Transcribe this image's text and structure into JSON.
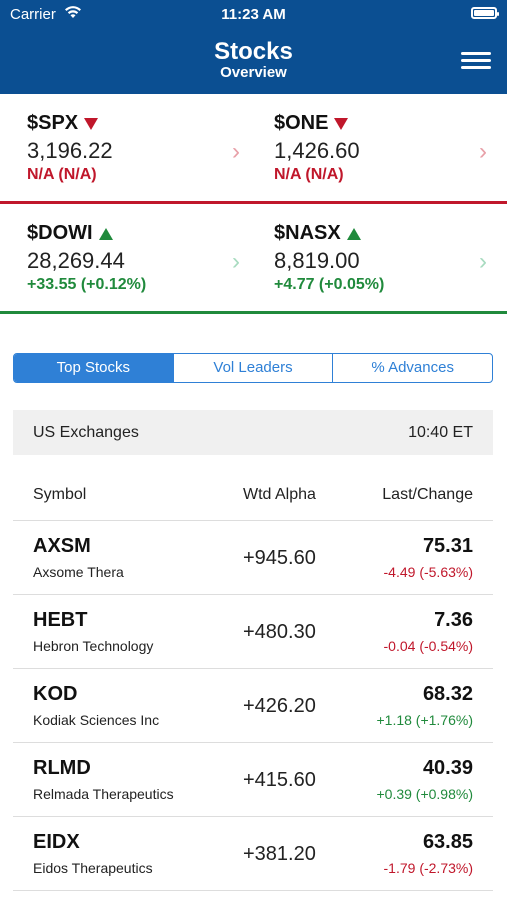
{
  "status": {
    "carrier": "Carrier",
    "time": "11:23 AM"
  },
  "header": {
    "title": "Stocks",
    "subtitle": "Overview"
  },
  "indices": [
    {
      "symbol": "$SPX",
      "price": "3,196.22",
      "change": "N/A (N/A)",
      "direction": "down",
      "color": "#c0172b"
    },
    {
      "symbol": "$ONE",
      "price": "1,426.60",
      "change": "N/A (N/A)",
      "direction": "down",
      "color": "#c0172b"
    },
    {
      "symbol": "$DOWI",
      "price": "28,269.44",
      "change": "+33.55 (+0.12%)",
      "direction": "up",
      "color": "#208a3c"
    },
    {
      "symbol": "$NASX",
      "price": "8,819.00",
      "change": "+4.77 (+0.05%)",
      "direction": "up",
      "color": "#208a3c"
    }
  ],
  "tabs": [
    {
      "label": "Top Stocks",
      "active": true
    },
    {
      "label": "Vol Leaders",
      "active": false
    },
    {
      "label": "% Advances",
      "active": false
    }
  ],
  "exchange": {
    "label": "US Exchanges",
    "time": "10:40 ET"
  },
  "table": {
    "headers": {
      "symbol": "Symbol",
      "alpha": "Wtd Alpha",
      "last": "Last/Change"
    },
    "rows": [
      {
        "symbol": "AXSM",
        "name": "Axsome Thera",
        "alpha": "+945.60",
        "last": "75.31",
        "change": "-4.49 (-5.63%)",
        "direction": "down"
      },
      {
        "symbol": "HEBT",
        "name": "Hebron Technology",
        "alpha": "+480.30",
        "last": "7.36",
        "change": "-0.04 (-0.54%)",
        "direction": "down"
      },
      {
        "symbol": "KOD",
        "name": "Kodiak Sciences Inc",
        "alpha": "+426.20",
        "last": "68.32",
        "change": "+1.18 (+1.76%)",
        "direction": "up"
      },
      {
        "symbol": "RLMD",
        "name": "Relmada Therapeutics",
        "alpha": "+415.60",
        "last": "40.39",
        "change": "+0.39 (+0.98%)",
        "direction": "up"
      },
      {
        "symbol": "EIDX",
        "name": "Eidos Therapeutics",
        "alpha": "+381.20",
        "last": "63.85",
        "change": "-1.79 (-2.73%)",
        "direction": "down"
      }
    ]
  },
  "colors": {
    "header_bg": "#0b4f92",
    "accent": "#2f80d6",
    "negative": "#c0172b",
    "positive": "#208a3c"
  }
}
